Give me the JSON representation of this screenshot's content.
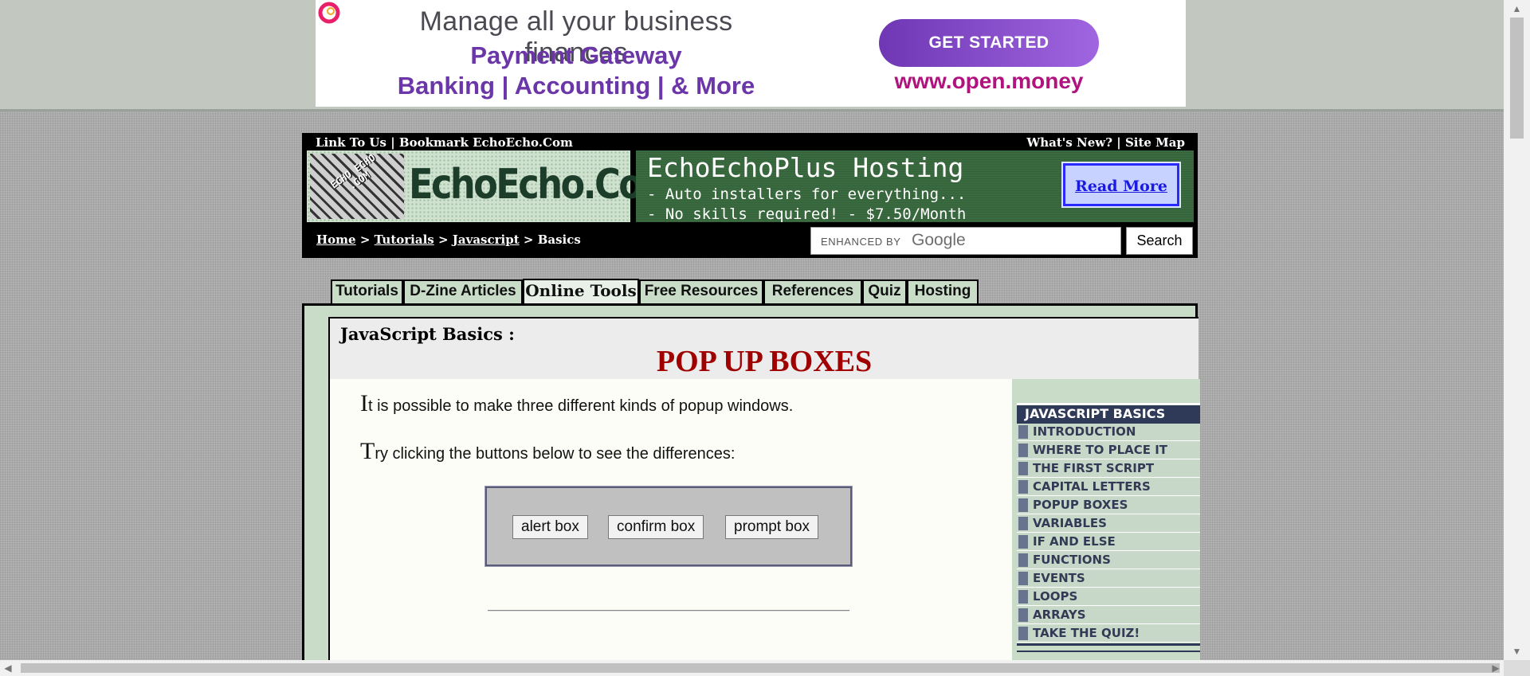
{
  "ad": {
    "line1": "Manage all your business finances",
    "line2": "Payment Gateway",
    "line3": "Banking | Accounting | & More",
    "cta": "GET STARTED",
    "url": "www.open.money"
  },
  "header": {
    "link_to_us": "Link To Us",
    "separator": "|",
    "bookmark": "Bookmark EchoEcho.Com",
    "whats_new": "What's New?",
    "site_map": "Site Map",
    "logo_name": "EchoEcho.Com",
    "logo_mark_text": "ECHO ECHO .COM"
  },
  "hosting_banner": {
    "title": "EchoEchoPlus Hosting",
    "line1": "- Auto installers for everything...",
    "line2": "- No skills required! - $7.50/Month",
    "read_more": "Read More"
  },
  "breadcrumb": {
    "home": "Home",
    "tutorials": "Tutorials",
    "javascript": "Javascript",
    "current": "Basics",
    "sep": ">"
  },
  "search": {
    "enhanced_by": "ENHANCED BY",
    "google": "Google",
    "button": "Search"
  },
  "tabs": [
    {
      "label": "Tutorials"
    },
    {
      "label": "D-Zine Articles"
    },
    {
      "label": "Online Tools",
      "active": true
    },
    {
      "label": "Free Resources"
    },
    {
      "label": "References"
    },
    {
      "label": "Quiz"
    },
    {
      "label": "Hosting"
    }
  ],
  "page": {
    "subtitle": "JavaScript Basics :",
    "title": "POP UP BOXES",
    "para1_cap": "I",
    "para1_rest": "t is possible to make three different kinds of popup windows.",
    "para2_cap": "T",
    "para2_rest": "ry clicking the buttons below to see the differences:",
    "buttons": {
      "alert": "alert box",
      "confirm": "confirm box",
      "prompt": "prompt box"
    }
  },
  "sidebar": {
    "heading": "JAVASCRIPT BASICS",
    "items": [
      {
        "label": "INTRODUCTION"
      },
      {
        "label": "WHERE TO PLACE IT"
      },
      {
        "label": "THE FIRST SCRIPT"
      },
      {
        "label": "CAPITAL LETTERS"
      },
      {
        "label": "POPUP BOXES"
      },
      {
        "label": "VARIABLES"
      },
      {
        "label": "IF AND ELSE"
      },
      {
        "label": "FUNCTIONS"
      },
      {
        "label": "EVENTS"
      },
      {
        "label": "LOOPS"
      },
      {
        "label": "ARRAYS"
      },
      {
        "label": "TAKE THE QUIZ!"
      }
    ]
  },
  "colors": {
    "title_red": "#a00000",
    "ad_purple": "#6b36a8",
    "sidebar_heading": "#2f3a58",
    "frame_green": "#c8dcc8"
  }
}
